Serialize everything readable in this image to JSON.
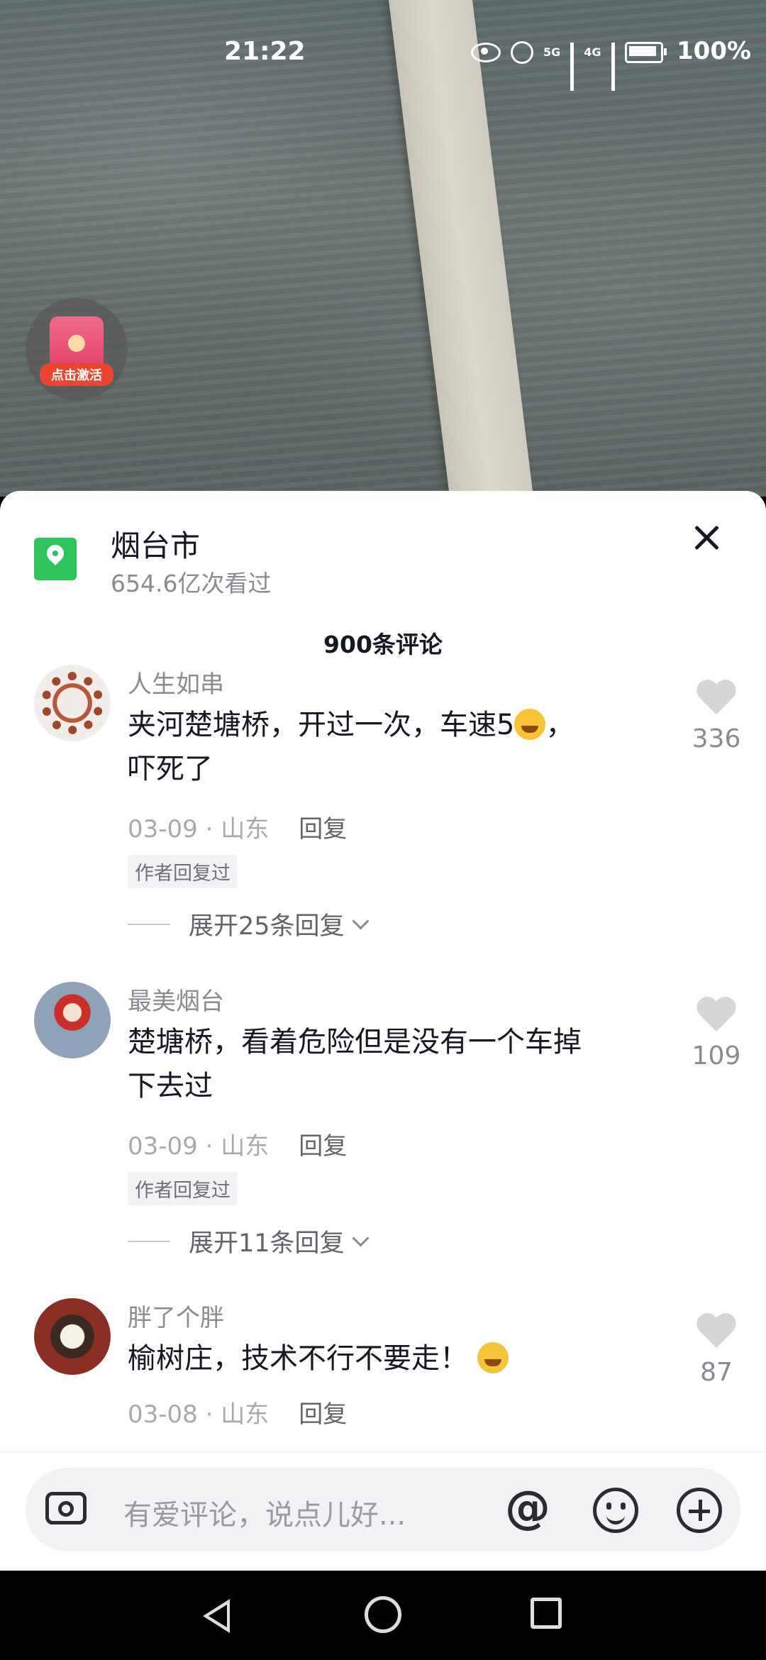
{
  "status_bar": {
    "time": "21:22",
    "signal1": "5G",
    "signal2": "4G",
    "battery": "100%"
  },
  "video": {
    "badge_label": "点击激活"
  },
  "location": {
    "name": "烟台市",
    "views": "654.6亿次看过"
  },
  "comments_header": {
    "count": "900条评论"
  },
  "comments": [
    {
      "author": "人生如串",
      "text_line1": "夹河楚塘桥，开过一次，车速5",
      "text_line1_after": "，",
      "text_line2": "吓死了",
      "date": "03-09 · 山东",
      "reply": "回复",
      "author_tag": "作者回复过",
      "expand": "展开25条回复",
      "likes": "336"
    },
    {
      "author": "最美烟台",
      "text_line1": "楚塘桥，看着危险但是没有一个车掉",
      "text_line2": "下去过",
      "date": "03-09 · 山东",
      "reply": "回复",
      "author_tag": "作者回复过",
      "expand": "展开11条回复",
      "likes": "109"
    },
    {
      "author": "胖了个胖",
      "text_line1": "榆树庄，技术不行不要走！",
      "date": "03-08 · 山东",
      "reply": "回复",
      "likes": "87"
    }
  ],
  "input_bar": {
    "placeholder": "有爱评论，说点儿好...",
    "at_symbol": "@"
  },
  "colors": {
    "accent_green": "#2ec45b",
    "text_primary": "#161823",
    "text_secondary": "#8a8b91"
  }
}
